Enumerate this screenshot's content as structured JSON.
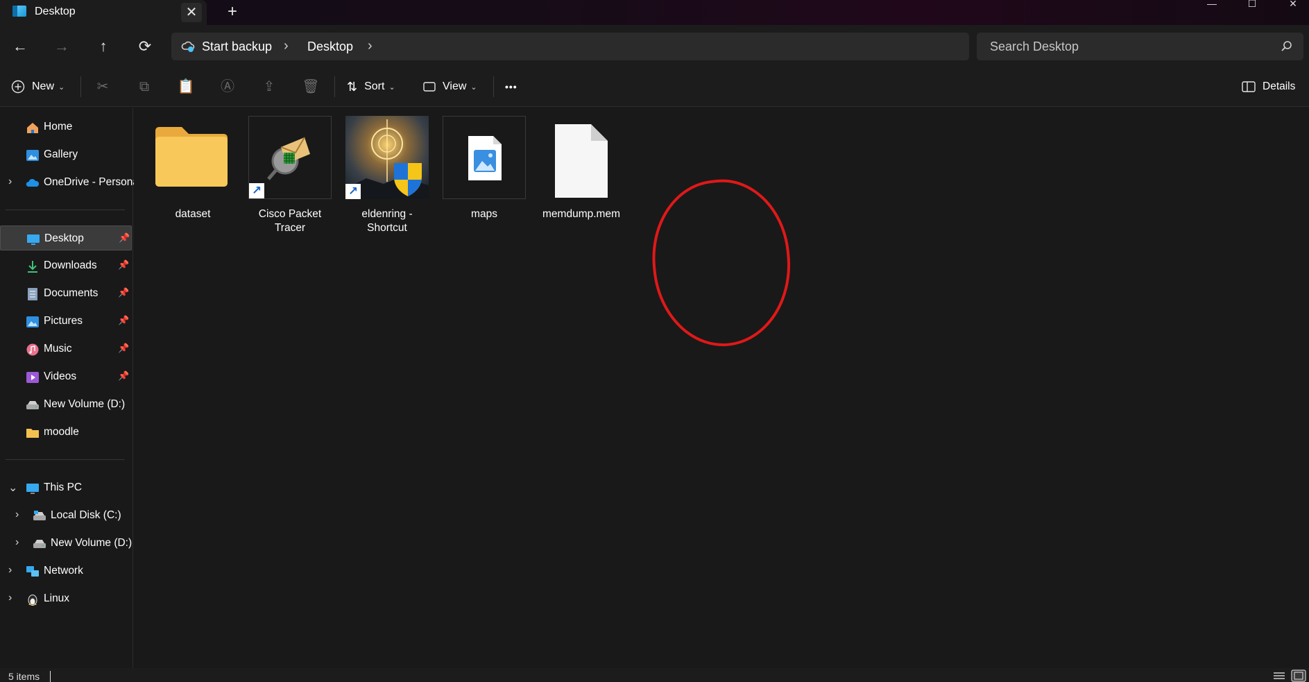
{
  "window": {
    "tab_title": "Desktop",
    "tab_close": "✕",
    "tab_add": "+",
    "minimize": "—",
    "maximize": "☐",
    "close": "✕"
  },
  "nav": {
    "back": "←",
    "forward": "→",
    "up": "↑",
    "refresh": "⟳",
    "breadcrumbs": [
      "Start backup",
      "Desktop"
    ],
    "separator": "›",
    "search_placeholder": "Search Desktop"
  },
  "toolbar": {
    "new_label": "New",
    "sort_label": "Sort",
    "view_label": "View",
    "more_label": "•••",
    "details_label": "Details",
    "chevron": "⌄",
    "icons": [
      "cut-icon",
      "copy-icon",
      "paste-icon",
      "rename-icon",
      "share-icon",
      "delete-icon"
    ]
  },
  "sidebar": {
    "quick": [
      {
        "label": "Home",
        "icon": "home-icon"
      },
      {
        "label": "Gallery",
        "icon": "gallery-icon"
      },
      {
        "label": "OneDrive - Persona",
        "icon": "onedrive-icon"
      }
    ],
    "pinned": [
      {
        "label": "Desktop",
        "icon": "desktop-icon"
      },
      {
        "label": "Downloads",
        "icon": "downloads-icon"
      },
      {
        "label": "Documents",
        "icon": "documents-icon"
      },
      {
        "label": "Pictures",
        "icon": "pictures-icon"
      },
      {
        "label": "Music",
        "icon": "music-icon"
      },
      {
        "label": "Videos",
        "icon": "videos-icon"
      },
      {
        "label": "New Volume (D:)",
        "icon": "drive-icon"
      },
      {
        "label": "moodle",
        "icon": "folder-icon"
      }
    ],
    "tree": [
      {
        "label": "This PC",
        "icon": "pc-icon"
      },
      {
        "label": "Local Disk (C:)",
        "icon": "drive-icon"
      },
      {
        "label": "New Volume (D:)",
        "icon": "drive-icon"
      },
      {
        "label": "Network",
        "icon": "network-icon"
      },
      {
        "label": "Linux",
        "icon": "linux-icon"
      }
    ],
    "pin_glyph": "📌",
    "expand_glyph": "›",
    "expanded_glyph": "⌄"
  },
  "files": [
    {
      "name": "dataset",
      "type": "folder"
    },
    {
      "name": "Cisco Packet Tracer",
      "type": "shortcut"
    },
    {
      "name": "eldenring - Shortcut",
      "type": "shortcut"
    },
    {
      "name": "maps",
      "type": "image"
    },
    {
      "name": "memdump.mem",
      "type": "file"
    }
  ],
  "status": {
    "item_count": "5 items"
  },
  "colors": {
    "highlight_circle": "#e01818",
    "folder": "#f4c150",
    "accent": "#4cc2ff"
  }
}
